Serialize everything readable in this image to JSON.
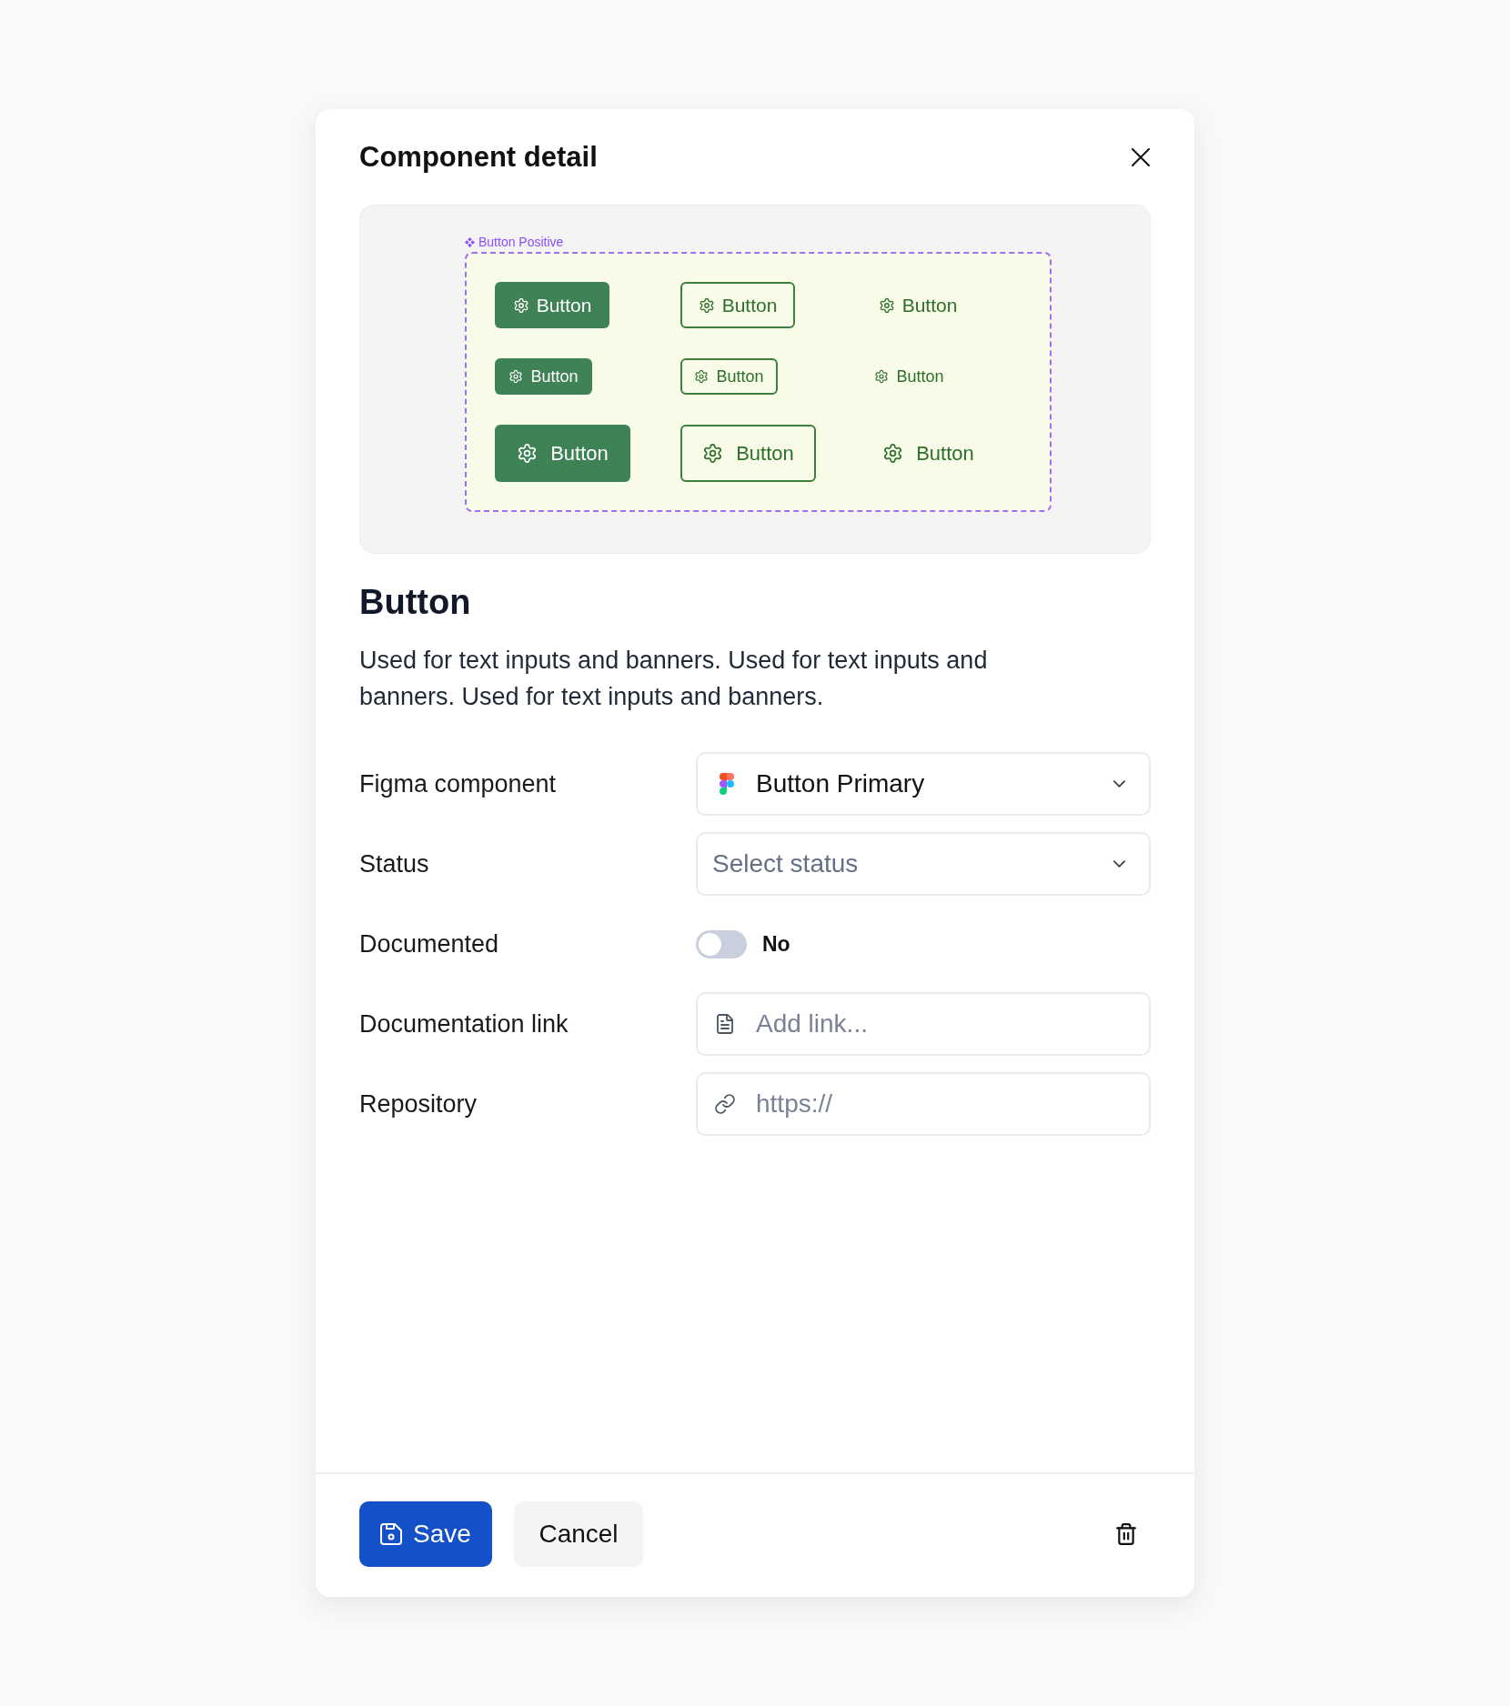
{
  "dialog": {
    "title": "Component detail"
  },
  "preview": {
    "frame_label": "Button Positive",
    "rows": [
      {
        "kind": "medium",
        "buttons": [
          {
            "kind": "filled",
            "label": "Button"
          },
          {
            "kind": "outline",
            "label": "Button"
          },
          {
            "kind": "ghost",
            "label": "Button"
          }
        ]
      },
      {
        "kind": "small",
        "buttons": [
          {
            "kind": "filled",
            "label": "Button"
          },
          {
            "kind": "outline",
            "label": "Button"
          },
          {
            "kind": "ghost",
            "label": "Button"
          }
        ]
      },
      {
        "kind": "large",
        "buttons": [
          {
            "kind": "filled",
            "label": "Button"
          },
          {
            "kind": "outline",
            "label": "Button"
          },
          {
            "kind": "ghost",
            "label": "Button"
          }
        ]
      }
    ]
  },
  "component": {
    "name": "Button",
    "description": "Used for text inputs and banners. Used for text inputs and banners. Used for text inputs and banners."
  },
  "fields": [
    {
      "kind": "component",
      "label": "Figma component",
      "value": "Button Primary"
    },
    {
      "kind": "select",
      "label": "Status",
      "placeholder": "Select status"
    },
    {
      "kind": "toggle",
      "label": "Documented",
      "on": false,
      "state_label": "No"
    },
    {
      "kind": "document",
      "label": "Documentation link",
      "placeholder": "Add link..."
    },
    {
      "kind": "url",
      "label": "Repository",
      "placeholder": "https://"
    }
  ],
  "footer": {
    "buttons": [
      {
        "kind": "primary",
        "label": "Save"
      },
      {
        "kind": "secondary",
        "label": "Cancel"
      }
    ]
  }
}
